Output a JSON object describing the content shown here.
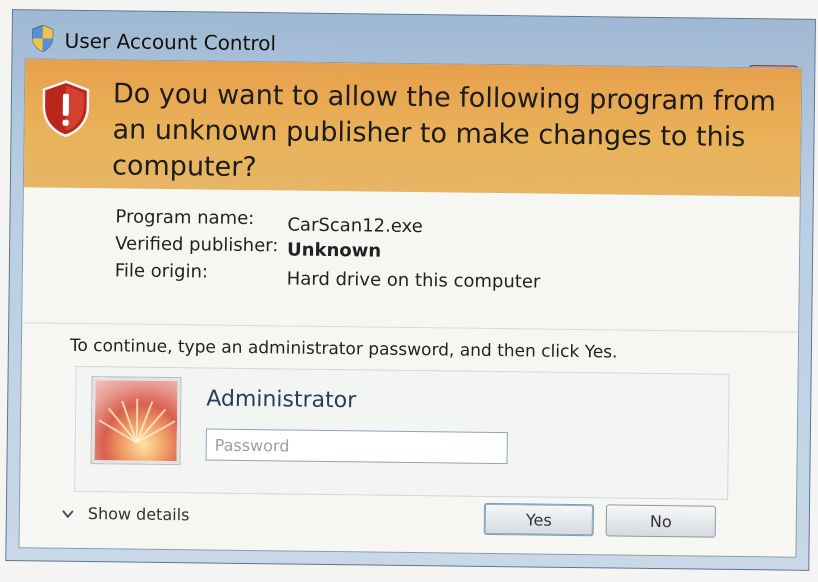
{
  "window": {
    "title": "User Account Control",
    "close_label": "✕"
  },
  "banner": {
    "question": "Do you want to allow the following program from an unknown publisher to make changes to this computer?"
  },
  "details": [
    {
      "label": "Program name:",
      "value": "CarScan12.exe"
    },
    {
      "label": "Verified publisher:",
      "value": "Unknown"
    },
    {
      "label": "File origin:",
      "value": "Hard drive on this computer"
    }
  ],
  "prompt": "To continue, type an administrator password, and then click Yes.",
  "credential": {
    "user_name": "Administrator",
    "password_placeholder": "Password",
    "password_value": ""
  },
  "footer": {
    "show_details": "Show details",
    "yes_label": "Yes",
    "no_label": "No"
  },
  "icons": {
    "title_icon": "uac-shield-icon",
    "banner_icon": "warning-shield-icon",
    "expander_icon": "chevron-down-icon",
    "avatar": "user-avatar-flower"
  },
  "colors": {
    "banner": "#e7a04c",
    "title_bar": "#9fb8d3",
    "close_button": "#c0503f"
  }
}
